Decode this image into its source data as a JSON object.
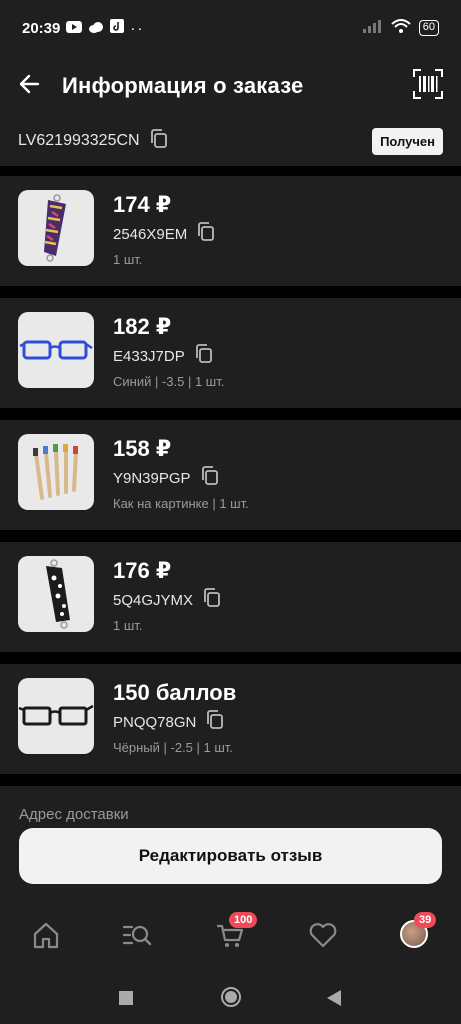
{
  "status_bar": {
    "time": "20:39",
    "battery": "60"
  },
  "header": {
    "title": "Информация о заказе"
  },
  "order": {
    "number": "LV621993325CN",
    "status": "Получен"
  },
  "items": [
    {
      "price": "174 ₽",
      "sku": "2546X9EM",
      "meta": "1 шт."
    },
    {
      "price": "182 ₽",
      "sku": "E433J7DP",
      "meta": "Синий | -3.5 | 1 шт."
    },
    {
      "price": "158 ₽",
      "sku": "Y9N39PGP",
      "meta": "Как на картинке | 1 шт."
    },
    {
      "price": "176 ₽",
      "sku": "5Q4GJYMX",
      "meta": "1 шт."
    },
    {
      "price": "150 баллов",
      "sku": "PNQQ78GN",
      "meta": "Чёрный | -2.5 | 1 шт."
    }
  ],
  "address": {
    "label": "Адрес доставки"
  },
  "edit_button": {
    "label": "Редактировать отзыв"
  },
  "bottom_nav": {
    "cart_badge": "100",
    "profile_badge": "39"
  }
}
